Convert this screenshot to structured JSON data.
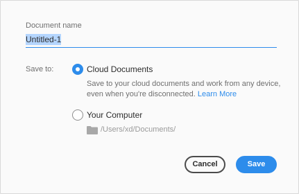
{
  "document": {
    "label": "Document name",
    "value": "Untitled-1"
  },
  "save_to": {
    "label": "Save to:",
    "options": [
      {
        "label": "Cloud Documents",
        "selected": true,
        "description": "Save to your cloud documents and work from any device, even when you're disconnected.",
        "link": "Learn More"
      },
      {
        "label": "Your Computer",
        "selected": false,
        "path": "/Users/xd/Documents/"
      }
    ]
  },
  "buttons": {
    "cancel": "Cancel",
    "save": "Save"
  },
  "colors": {
    "accent": "#2d8ceb",
    "text": "#2c2c2c",
    "muted": "#6f6f6f",
    "selection": "#b4d5fe"
  },
  "icons": {
    "folder": "folder-icon"
  }
}
